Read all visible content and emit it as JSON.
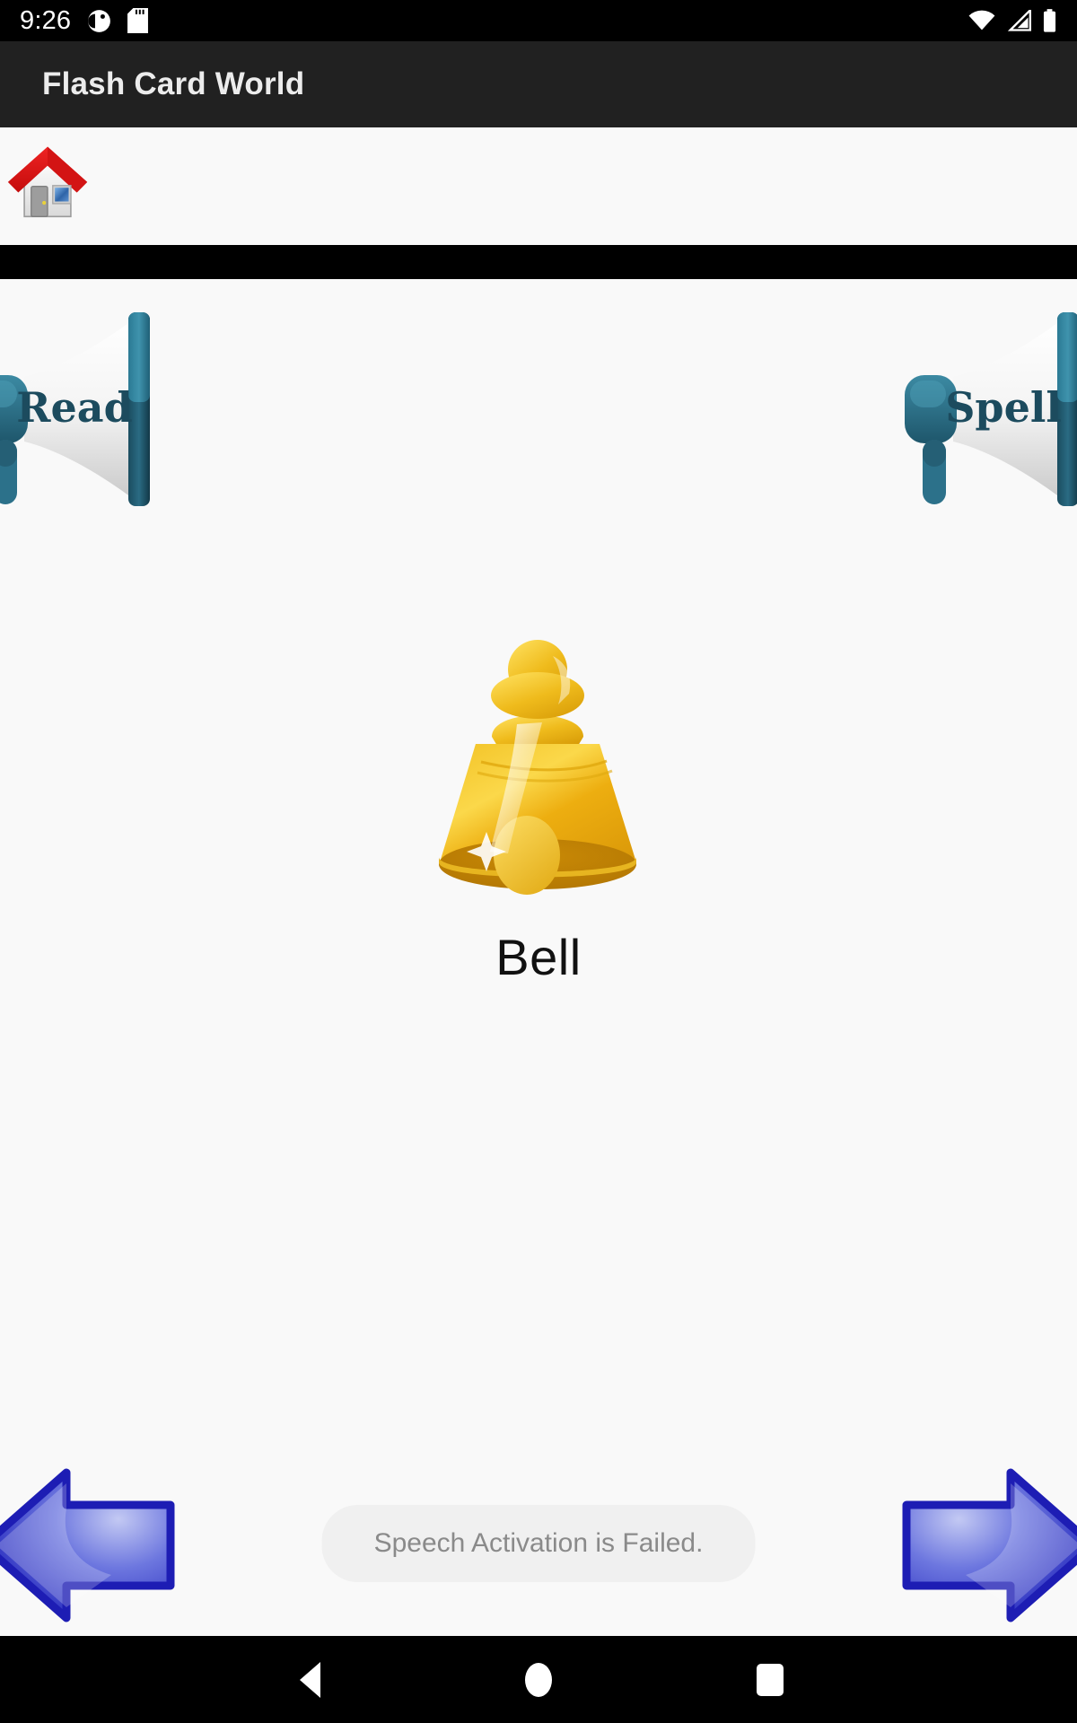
{
  "status_bar": {
    "clock": "9:26",
    "left_icons": [
      "app-notification-icon",
      "sd-card-icon"
    ],
    "right_icons": [
      "wifi-icon",
      "cellular-signal-icon",
      "battery-icon"
    ],
    "background_color": "#000000",
    "foreground_color": "#ffffff"
  },
  "app_bar": {
    "title": "Flash Card World",
    "background_color": "#212121",
    "text_color": "#ececec"
  },
  "toolbar": {
    "home_icon": "home-icon",
    "home_label": "Home"
  },
  "divider": {
    "color": "#000000"
  },
  "controls": {
    "read_button": {
      "icon": "megaphone-icon",
      "label": "Read"
    },
    "spell_button": {
      "icon": "megaphone-icon",
      "label": "Spell"
    }
  },
  "flash_card": {
    "image": "bell-icon",
    "word": "Bell"
  },
  "navigation": {
    "previous_icon": "arrow-left-icon",
    "next_icon": "arrow-right-icon"
  },
  "toast": {
    "message": "Speech Activation is Failed.",
    "background_color": "#f0f0f0",
    "text_color": "#8a8a8a"
  },
  "system_nav": {
    "back_icon": "triangle-back-icon",
    "home_icon": "circle-home-icon",
    "recents_icon": "square-recents-icon",
    "background_color": "#000000"
  },
  "theme": {
    "page_background": "#f9f9f9",
    "megaphone_teal": "#2e6d83",
    "megaphone_dark": "#1d4a5c",
    "bell_gold": "#f0bc20",
    "arrow_blue": "#2626c8"
  }
}
